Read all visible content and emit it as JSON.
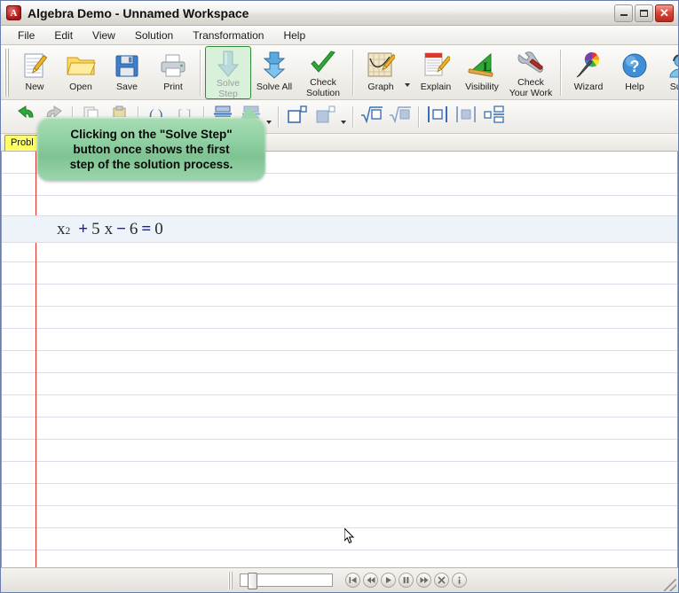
{
  "window": {
    "title": "Algebra Demo - Unnamed Workspace",
    "app_icon": "A",
    "minimize_label": "Minimize",
    "maximize_label": "Maximize",
    "close_label": "Close",
    "close_glyph": "✕"
  },
  "menu": {
    "items": [
      {
        "label": "File"
      },
      {
        "label": "Edit"
      },
      {
        "label": "View"
      },
      {
        "label": "Solution"
      },
      {
        "label": "Transformation"
      },
      {
        "label": "Help"
      }
    ]
  },
  "toolbar_main": {
    "buttons": [
      {
        "label": "New",
        "icon": "new-document-icon",
        "state": "enabled"
      },
      {
        "label": "Open",
        "icon": "open-folder-icon",
        "state": "enabled"
      },
      {
        "label": "Save",
        "icon": "floppy-disk-icon",
        "state": "enabled"
      },
      {
        "label": "Print",
        "icon": "printer-icon",
        "state": "enabled"
      },
      {
        "label": "Solve\nStep",
        "icon": "down-arrow-icon",
        "state": "highlighted-disabled"
      },
      {
        "label": "Solve All",
        "icon": "double-down-arrow-icon",
        "state": "enabled"
      },
      {
        "label": "Check\nSolution",
        "icon": "green-check-icon",
        "state": "enabled"
      },
      {
        "label": "Graph",
        "icon": "graph-chart-icon",
        "state": "enabled",
        "has_dropdown": true
      },
      {
        "label": "Explain",
        "icon": "explain-paper-icon",
        "state": "enabled"
      },
      {
        "label": "Visibility",
        "icon": "visibility-triangle-icon",
        "state": "enabled"
      },
      {
        "label": "Check\nYour Work",
        "icon": "wrench-icon",
        "state": "enabled"
      },
      {
        "label": "Wizard",
        "icon": "magic-wand-icon",
        "state": "enabled"
      },
      {
        "label": "Help",
        "icon": "question-mark-icon",
        "state": "enabled"
      },
      {
        "label": "Supp",
        "icon": "support-headset-icon",
        "state": "enabled"
      }
    ],
    "labels": {
      "new": "New",
      "open": "Open",
      "save": "Save",
      "print": "Print",
      "solve_step_l1": "Solve",
      "solve_step_l2": "Step",
      "solve_all": "Solve All",
      "check_solution_l1": "Check",
      "check_solution_l2": "Solution",
      "graph": "Graph",
      "explain": "Explain",
      "visibility": "Visibility",
      "check_your_work_l1": "Check",
      "check_your_work_l2": "Your Work",
      "wizard": "Wizard",
      "help": "Help",
      "support": "Supp"
    },
    "overflow_glyph": "»"
  },
  "toolbar_format": {
    "buttons": [
      {
        "icon": "undo-arrow-icon"
      },
      {
        "icon": "divide-icon"
      },
      {
        "icon": "stack-fraction-icon"
      },
      {
        "icon": "stack-align-icon",
        "has_dropdown": true
      },
      {
        "icon": "superscript-square-icon"
      },
      {
        "icon": "subscript-filled-square-icon",
        "has_dropdown": true
      },
      {
        "icon": "radical-empty-icon"
      },
      {
        "icon": "radical-filled-icon"
      },
      {
        "icon": "absolute-value-empty-icon"
      },
      {
        "icon": "absolute-value-filled-icon"
      },
      {
        "icon": "fraction-small-icon"
      }
    ]
  },
  "tabstrip": {
    "tab_label": "Probl"
  },
  "workspace": {
    "equation": {
      "parts": [
        {
          "text": "x",
          "kind": "term"
        },
        {
          "text": "2",
          "kind": "exponent"
        },
        {
          "text": "+",
          "kind": "op"
        },
        {
          "text": "5",
          "kind": "term"
        },
        {
          "text": "x",
          "kind": "term"
        },
        {
          "text": "−",
          "kind": "op"
        },
        {
          "text": "6",
          "kind": "term"
        },
        {
          "text": "=",
          "kind": "op"
        },
        {
          "text": "0",
          "kind": "term"
        }
      ],
      "plain": "x^2 + 5 x - 6 = 0"
    }
  },
  "callout": {
    "line1": "Clicking on the \"Solve Step\"",
    "line2": "button once shows the first",
    "line3": "step of the solution process.",
    "full_text": "Clicking on the \"Solve Step\" button once shows the first step of the solution process."
  },
  "bottom_bar": {
    "slider_value": "0",
    "media_buttons": [
      {
        "name": "skip-to-start-button",
        "glyph": "skip-start"
      },
      {
        "name": "rewind-button",
        "glyph": "rewind"
      },
      {
        "name": "play-button",
        "glyph": "play"
      },
      {
        "name": "pause-button",
        "glyph": "pause"
      },
      {
        "name": "fast-forward-button",
        "glyph": "forward"
      },
      {
        "name": "stop-close-button",
        "glyph": "x"
      },
      {
        "name": "info-button",
        "glyph": "i"
      }
    ]
  },
  "colors": {
    "operator_blue": "#1515d6",
    "term_dark": "#2b2b2b",
    "margin_red": "#e03030",
    "rule_blue": "#dcdde8",
    "highlight_green": "#d9f0da",
    "callout_green": "#8fd0a2",
    "tab_yellow": "#ffff66",
    "close_red": "#d64a3c"
  }
}
